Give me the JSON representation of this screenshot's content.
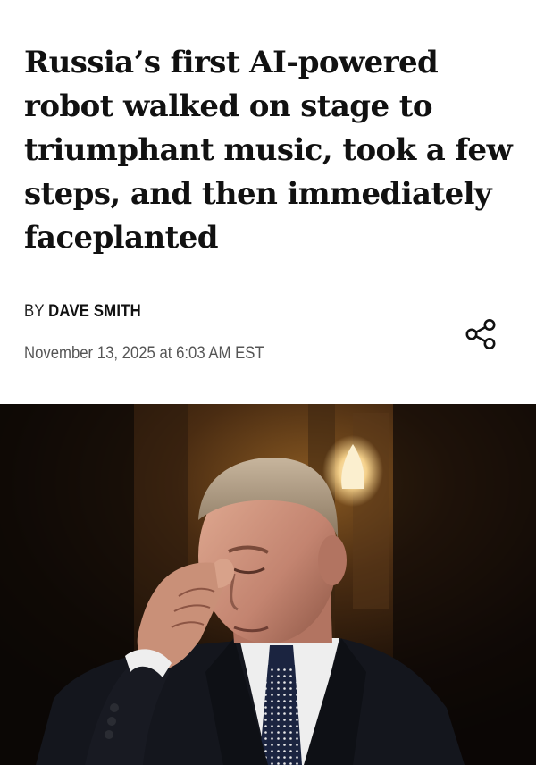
{
  "article": {
    "headline": "Russia’s first AI-powered robot walked on stage to triumphant music, took a few steps, and then immediately faceplanted",
    "byline_prefix": "BY",
    "author": "DAVE SMITH",
    "dateline": "November 13, 2025 at 6:03 AM EST"
  },
  "icons": {
    "share": "share-icon"
  },
  "hero_image": {
    "subject": "man-in-dark-suit-touching-forehead",
    "colors": {
      "background": "#120c07",
      "warm_light": "#8a5a22",
      "suit": "#14161d",
      "shirt": "#eeeeee",
      "tie": "#1b2440",
      "skin": "#c99078"
    }
  }
}
